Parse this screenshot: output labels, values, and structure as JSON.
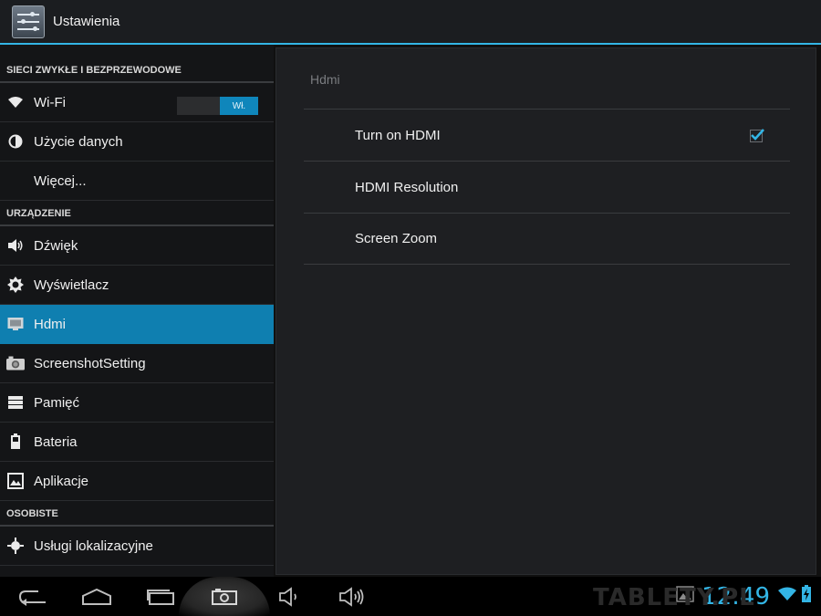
{
  "actionbar": {
    "title": "Ustawienia",
    "icon": "settings-sliders-icon"
  },
  "sidebar": {
    "sections": [
      {
        "header": "SIECI ZWYKŁE I BEZPRZEWODOWE"
      },
      {
        "header": "URZĄDZENIE"
      },
      {
        "header": "OSOBISTE"
      }
    ],
    "items": [
      {
        "label": "Wi-Fi",
        "icon": "wifi-icon",
        "toggle": "Wł."
      },
      {
        "label": "Użycie danych",
        "icon": "data-usage-icon"
      },
      {
        "label": "Więcej...",
        "icon": ""
      },
      {
        "label": "Dźwięk",
        "icon": "speaker-icon"
      },
      {
        "label": "Wyświetlacz",
        "icon": "brightness-icon"
      },
      {
        "label": "Hdmi",
        "icon": "monitor-icon",
        "selected": true
      },
      {
        "label": "ScreenshotSetting",
        "icon": "camera-icon"
      },
      {
        "label": "Pamięć",
        "icon": "storage-icon"
      },
      {
        "label": "Bateria",
        "icon": "battery-icon"
      },
      {
        "label": "Aplikacje",
        "icon": "apps-icon"
      },
      {
        "label": "Usługi lokalizacyjne",
        "icon": "location-icon"
      }
    ]
  },
  "main": {
    "title": "Hdmi",
    "prefs": [
      {
        "label": "Turn on HDMI",
        "checked": true
      },
      {
        "label": "HDMI Resolution"
      },
      {
        "label": "Screen Zoom"
      }
    ]
  },
  "statusbar": {
    "time": "12:49"
  },
  "watermark": "TABLETY.PL",
  "colors": {
    "accent": "#33b5e5",
    "selected": "#0f7fb0",
    "background": "#141517"
  }
}
